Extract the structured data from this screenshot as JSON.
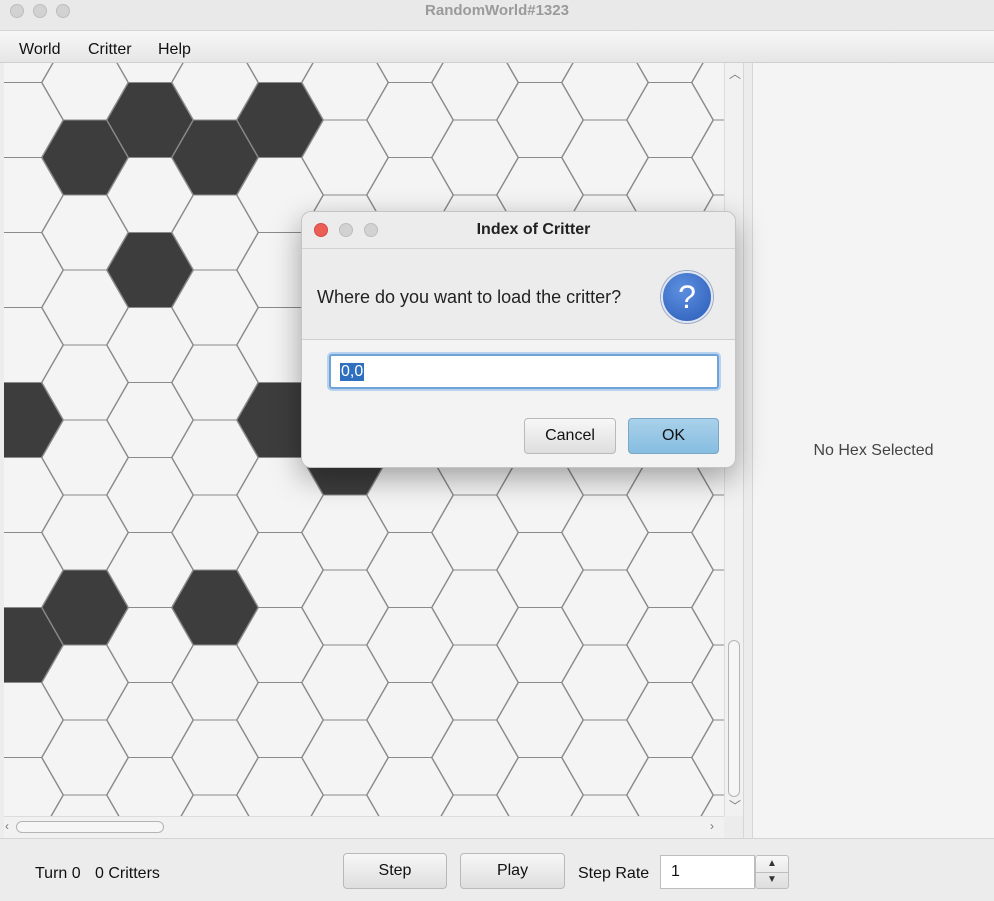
{
  "window": {
    "title": "RandomWorld#1323"
  },
  "menu": {
    "items": [
      {
        "label": "World"
      },
      {
        "label": "Critter"
      },
      {
        "label": "Help"
      }
    ]
  },
  "info_panel": {
    "text": "No Hex Selected"
  },
  "status": {
    "turn_label": "Turn 0",
    "critters_label": "0 Critters"
  },
  "controls": {
    "step_label": "Step",
    "play_label": "Play",
    "step_rate_label": "Step Rate",
    "step_rate_value": "1"
  },
  "dialog": {
    "title": "Index of Critter",
    "question": "Where do you want to load the critter?",
    "icon": "question-icon",
    "input_value": "0,0",
    "cancel_label": "Cancel",
    "ok_label": "OK"
  },
  "colors": {
    "filled_hex": "#3d3d3d",
    "empty_hex": "#f4f4f4",
    "ok_button": "#9ccae6",
    "dialog_close": "#ec5f57"
  }
}
